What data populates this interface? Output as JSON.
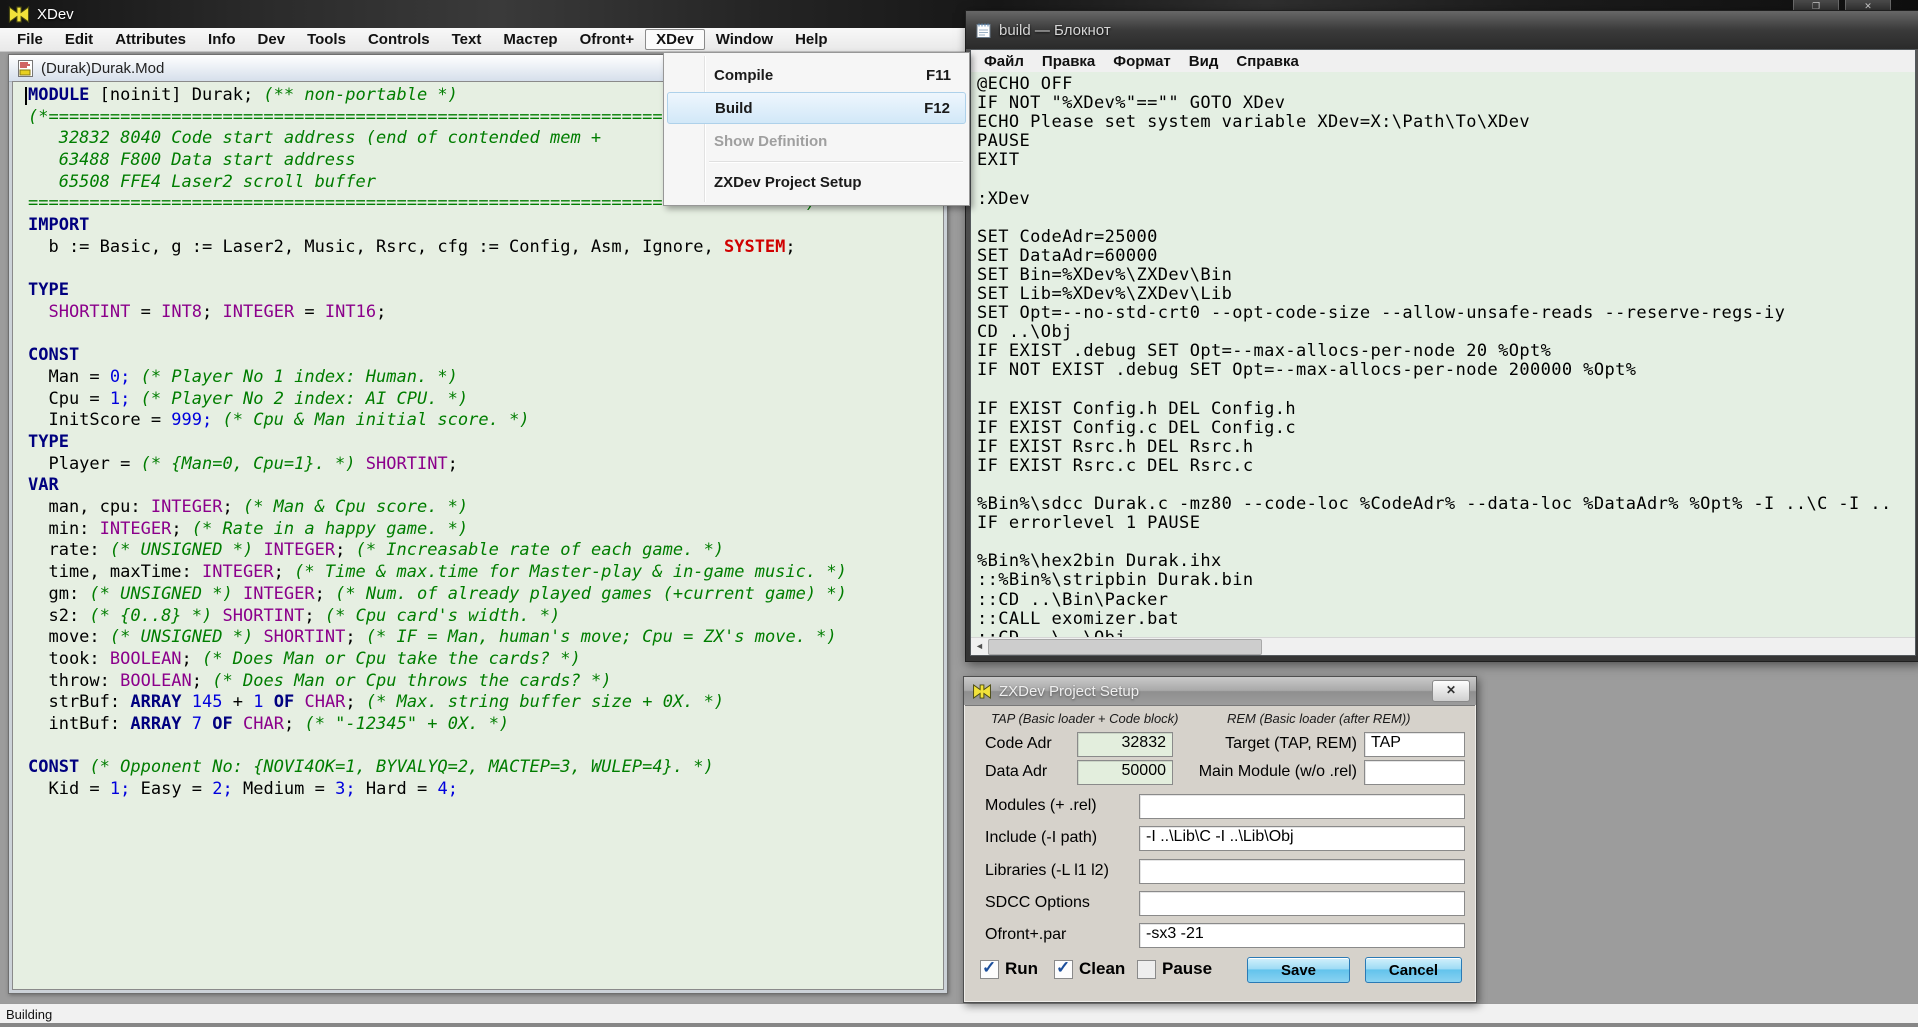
{
  "colors": {
    "editor_bg": "#e6efe2",
    "notepad_bg": "#e4efe3",
    "keyword": "#00007f",
    "comment": "#007d00",
    "number": "#0000dd",
    "type": "#8b008b",
    "system_red": "#d00000",
    "menu_highlight": "#d2e8f8",
    "dialog_bg": "#d6d2cb",
    "button_blue": "#63c3ec",
    "logo_yellow": "#f2e23a"
  },
  "icons": {
    "restore": "❐",
    "close": "✕",
    "dialog_close": "✕",
    "scroll_left": "◄"
  },
  "xdev_window": {
    "title": "XDev",
    "status": "Building",
    "menubar": {
      "items": [
        "File",
        "Edit",
        "Attributes",
        "Info",
        "Dev",
        "Tools",
        "Controls",
        "Text",
        "Мастер",
        "Ofront+",
        "XDev",
        "Window",
        "Help"
      ],
      "active": "XDev"
    }
  },
  "xdev_menu": {
    "items": [
      {
        "label": "Compile",
        "shortcut": "F11",
        "state": "normal"
      },
      {
        "label": "Build",
        "shortcut": "F12",
        "state": "highlighted"
      },
      {
        "label": "Show Definition",
        "shortcut": "",
        "state": "disabled"
      },
      {
        "label": "ZXDev Project Setup",
        "shortcut": "",
        "state": "normal",
        "separator_before": true
      }
    ]
  },
  "editor": {
    "doc_title": "(Durak)Durak.Mod",
    "code_lines": [
      [
        [
          "kw",
          "MODULE"
        ],
        [
          "pl",
          " [noinit] Durak; "
        ],
        [
          "cm",
          "(** non-portable *)"
        ]
      ],
      [
        [
          "cm",
          "(*=========================================================================="
        ]
      ],
      [
        [
          "cm",
          "   32832 8040 Code start address (end of contended mem +"
        ]
      ],
      [
        [
          "cm",
          "   63488 F800 Data start address"
        ]
      ],
      [
        [
          "cm",
          "   65508 FFE4 Laser2 scroll buffer"
        ]
      ],
      [
        [
          "cm",
          "===========================================================================*)"
        ]
      ],
      [
        [
          "kw",
          "IMPORT"
        ]
      ],
      [
        [
          "pl",
          "  b := Basic, g := Laser2, Music, Rsrc, cfg := Config, Asm, Ignore, "
        ],
        [
          "sys",
          "SYSTEM"
        ],
        [
          "pl",
          ";"
        ]
      ],
      [],
      [
        [
          "kw",
          "TYPE"
        ]
      ],
      [
        [
          "pl",
          "  "
        ],
        [
          "typ",
          "SHORTINT"
        ],
        [
          "pl",
          " = "
        ],
        [
          "typ",
          "INT8"
        ],
        [
          "pl",
          "; "
        ],
        [
          "typ",
          "INTEGER"
        ],
        [
          "pl",
          " = "
        ],
        [
          "typ",
          "INT16"
        ],
        [
          "pl",
          ";"
        ]
      ],
      [],
      [
        [
          "kw",
          "CONST"
        ]
      ],
      [
        [
          "pl",
          "  Man = "
        ],
        [
          "num",
          "0;"
        ],
        [
          "pl",
          " "
        ],
        [
          "cm",
          "(* Player No 1 index: Human. *)"
        ]
      ],
      [
        [
          "pl",
          "  Cpu = "
        ],
        [
          "num",
          "1;"
        ],
        [
          "pl",
          " "
        ],
        [
          "cm",
          "(* Player No 2 index: AI CPU. *)"
        ]
      ],
      [
        [
          "pl",
          "  InitScore = "
        ],
        [
          "num",
          "999;"
        ],
        [
          "pl",
          " "
        ],
        [
          "cm",
          "(* Cpu & Man initial score. *)"
        ]
      ],
      [
        [
          "kw",
          "TYPE"
        ]
      ],
      [
        [
          "pl",
          "  Player = "
        ],
        [
          "cm",
          "(* {Man=0, Cpu=1}. *)"
        ],
        [
          "pl",
          " "
        ],
        [
          "typ",
          "SHORTINT"
        ],
        [
          "pl",
          ";"
        ]
      ],
      [
        [
          "kw",
          "VAR"
        ]
      ],
      [
        [
          "pl",
          "  man, cpu: "
        ],
        [
          "typ",
          "INTEGER"
        ],
        [
          "pl",
          "; "
        ],
        [
          "cm",
          "(* Man & Cpu score. *)"
        ]
      ],
      [
        [
          "pl",
          "  min: "
        ],
        [
          "typ",
          "INTEGER"
        ],
        [
          "pl",
          "; "
        ],
        [
          "cm",
          "(* Rate in a happy game. *)"
        ]
      ],
      [
        [
          "pl",
          "  rate: "
        ],
        [
          "cm",
          "(* UNSIGNED *)"
        ],
        [
          "pl",
          " "
        ],
        [
          "typ",
          "INTEGER"
        ],
        [
          "pl",
          "; "
        ],
        [
          "cm",
          "(* Increasable rate of each game. *)"
        ]
      ],
      [
        [
          "pl",
          "  time, maxTime: "
        ],
        [
          "typ",
          "INTEGER"
        ],
        [
          "pl",
          "; "
        ],
        [
          "cm",
          "(* Time & max.time for Master-play & in-game music. *)"
        ]
      ],
      [
        [
          "pl",
          "  gm: "
        ],
        [
          "cm",
          "(* UNSIGNED *)"
        ],
        [
          "pl",
          " "
        ],
        [
          "typ",
          "INTEGER"
        ],
        [
          "pl",
          "; "
        ],
        [
          "cm",
          "(* Num. of already played games (+current game) *)"
        ]
      ],
      [
        [
          "pl",
          "  s2: "
        ],
        [
          "cm",
          "(* {0..8} *)"
        ],
        [
          "pl",
          " "
        ],
        [
          "typ",
          "SHORTINT"
        ],
        [
          "pl",
          "; "
        ],
        [
          "cm",
          "(* Cpu card's width. *)"
        ]
      ],
      [
        [
          "pl",
          "  move: "
        ],
        [
          "cm",
          "(* UNSIGNED *)"
        ],
        [
          "pl",
          " "
        ],
        [
          "typ",
          "SHORTINT"
        ],
        [
          "pl",
          "; "
        ],
        [
          "cm",
          "(* IF = Man, human's move; Cpu = ZX's move. *)"
        ]
      ],
      [
        [
          "pl",
          "  took: "
        ],
        [
          "typ",
          "BOOLEAN"
        ],
        [
          "pl",
          "; "
        ],
        [
          "cm",
          "(* Does Man or Cpu take the cards? *)"
        ]
      ],
      [
        [
          "pl",
          "  throw: "
        ],
        [
          "typ",
          "BOOLEAN"
        ],
        [
          "pl",
          "; "
        ],
        [
          "cm",
          "(* Does Man or Cpu throws the cards? *)"
        ]
      ],
      [
        [
          "pl",
          "  strBuf: "
        ],
        [
          "kw",
          "ARRAY"
        ],
        [
          "pl",
          " "
        ],
        [
          "num",
          "145"
        ],
        [
          "pl",
          " + "
        ],
        [
          "num",
          "1"
        ],
        [
          "pl",
          " "
        ],
        [
          "kw",
          "OF"
        ],
        [
          "pl",
          " "
        ],
        [
          "typ",
          "CHAR"
        ],
        [
          "pl",
          "; "
        ],
        [
          "cm",
          "(* Max. string buffer size + 0X. *)"
        ]
      ],
      [
        [
          "pl",
          "  intBuf: "
        ],
        [
          "kw",
          "ARRAY"
        ],
        [
          "pl",
          " "
        ],
        [
          "num",
          "7"
        ],
        [
          "pl",
          " "
        ],
        [
          "kw",
          "OF"
        ],
        [
          "pl",
          " "
        ],
        [
          "typ",
          "CHAR"
        ],
        [
          "pl",
          "; "
        ],
        [
          "cm",
          "(* \"-12345\" + 0X. *)"
        ]
      ],
      [],
      [
        [
          "kw",
          "CONST"
        ],
        [
          "pl",
          " "
        ],
        [
          "cm",
          "(* Opponent No: {NOVI4OK=1, BYVALYQ=2, MACTEP=3, WULEP=4}. *)"
        ]
      ],
      [
        [
          "pl",
          "  Kid = "
        ],
        [
          "num",
          "1;"
        ],
        [
          "pl",
          " Easy = "
        ],
        [
          "num",
          "2;"
        ],
        [
          "pl",
          " Medium = "
        ],
        [
          "num",
          "3;"
        ],
        [
          "pl",
          " Hard = "
        ],
        [
          "num",
          "4;"
        ]
      ]
    ]
  },
  "notepad": {
    "title": "build — Блокнот",
    "menubar": {
      "items": [
        "Файл",
        "Правка",
        "Формат",
        "Вид",
        "Справка"
      ]
    },
    "lines": [
      "@ECHO OFF",
      "IF NOT \"%XDev%\"==\"\" GOTO XDev",
      "ECHO Please set system variable XDev=X:\\Path\\To\\XDev",
      "PAUSE",
      "EXIT",
      "",
      ":XDev",
      "",
      "SET CodeAdr=25000",
      "SET DataAdr=60000",
      "SET Bin=%XDev%\\ZXDev\\Bin",
      "SET Lib=%XDev%\\ZXDev\\Lib",
      "SET Opt=--no-std-crt0 --opt-code-size --allow-unsafe-reads --reserve-regs-iy",
      "CD ..\\Obj",
      "IF EXIST .debug SET Opt=--max-allocs-per-node 20 %Opt%",
      "IF NOT EXIST .debug SET Opt=--max-allocs-per-node 200000 %Opt%",
      "",
      "IF EXIST Config.h DEL Config.h",
      "IF EXIST Config.c DEL Config.c",
      "IF EXIST Rsrc.h DEL Rsrc.h",
      "IF EXIST Rsrc.c DEL Rsrc.c",
      "",
      "%Bin%\\sdcc Durak.c -mz80 --code-loc %CodeAdr% --data-loc %DataAdr% %Opt% -I ..\\C -I ..",
      "IF errorlevel 1 PAUSE",
      "",
      "%Bin%\\hex2bin Durak.ihx",
      "::%Bin%\\stripbin Durak.bin",
      "::CD ..\\Bin\\Packer",
      "::CALL exomizer.bat",
      "::CD ..\\..\\Obj"
    ]
  },
  "dialog": {
    "title": "ZXDev Project Setup",
    "hint_tap": "TAP (Basic loader + Code block)",
    "hint_rem": "REM (Basic loader (after REM))",
    "rows": [
      {
        "label": "Code Adr",
        "value": "32832",
        "label2": "Target (TAP, REM)",
        "value2": "TAP"
      },
      {
        "label": "Data Adr",
        "value": "50000",
        "label2": "Main Module (w/o .rel)",
        "value2": ""
      },
      {
        "label": "Modules (+ .rel)",
        "value": ""
      },
      {
        "label": "Include (-I path)",
        "value": "-I ..\\Lib\\C -I ..\\Lib\\Obj"
      },
      {
        "label": "Libraries (-L l1 l2)",
        "value": ""
      },
      {
        "label": "SDCC Options",
        "value": ""
      },
      {
        "label": "Ofront+.par",
        "value": "-sx3 -21"
      }
    ],
    "checkboxes": [
      {
        "label": "Run",
        "checked": true
      },
      {
        "label": "Clean",
        "checked": true
      },
      {
        "label": "Pause",
        "checked": false
      }
    ],
    "buttons": [
      {
        "label": "Save"
      },
      {
        "label": "Cancel"
      }
    ]
  }
}
